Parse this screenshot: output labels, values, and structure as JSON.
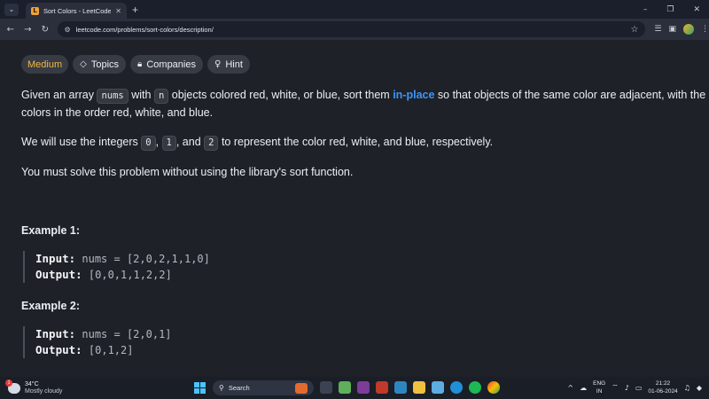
{
  "browser": {
    "tab_title": "Sort Colors - LeetCode",
    "url": "leetcode.com/problems/sort-colors/description/"
  },
  "pills": {
    "difficulty": "Medium",
    "topics": "Topics",
    "companies": "Companies",
    "hint": "Hint"
  },
  "description": {
    "p1_a": "Given an array ",
    "p1_code1": "nums",
    "p1_b": " with ",
    "p1_code2": "n",
    "p1_c": " objects colored red, white, or blue, sort them ",
    "p1_link": "in-place",
    "p1_d": " so that objects of the same color are adjacent, with the colors in the order red, white, and blue.",
    "p2_a": "We will use the integers ",
    "p2_code1": "0",
    "p2_b": ", ",
    "p2_code2": "1",
    "p2_c": ", and ",
    "p2_code3": "2",
    "p2_d": " to represent the color red, white, and blue, respectively.",
    "p3": "You must solve this problem without using the library's sort function."
  },
  "examples": [
    {
      "title": "Example 1:",
      "input_label": "Input:",
      "input": " nums = [2,0,2,1,1,0]",
      "output_label": "Output:",
      "output": " [0,0,1,1,2,2]"
    },
    {
      "title": "Example 2:",
      "input_label": "Input:",
      "input": " nums = [2,0,1]",
      "output_label": "Output:",
      "output": " [0,1,2]"
    }
  ],
  "taskbar": {
    "temperature": "34°C",
    "condition": "Mostly cloudy",
    "weather_badge": "1",
    "search_placeholder": "Search",
    "lang_1": "ENG",
    "lang_2": "IN",
    "time": "21:22",
    "date": "01-06-2024"
  },
  "colors": {
    "difficulty_medium": "#f5b83d",
    "link_blue": "#3d95f7",
    "background": "#1e2127"
  }
}
